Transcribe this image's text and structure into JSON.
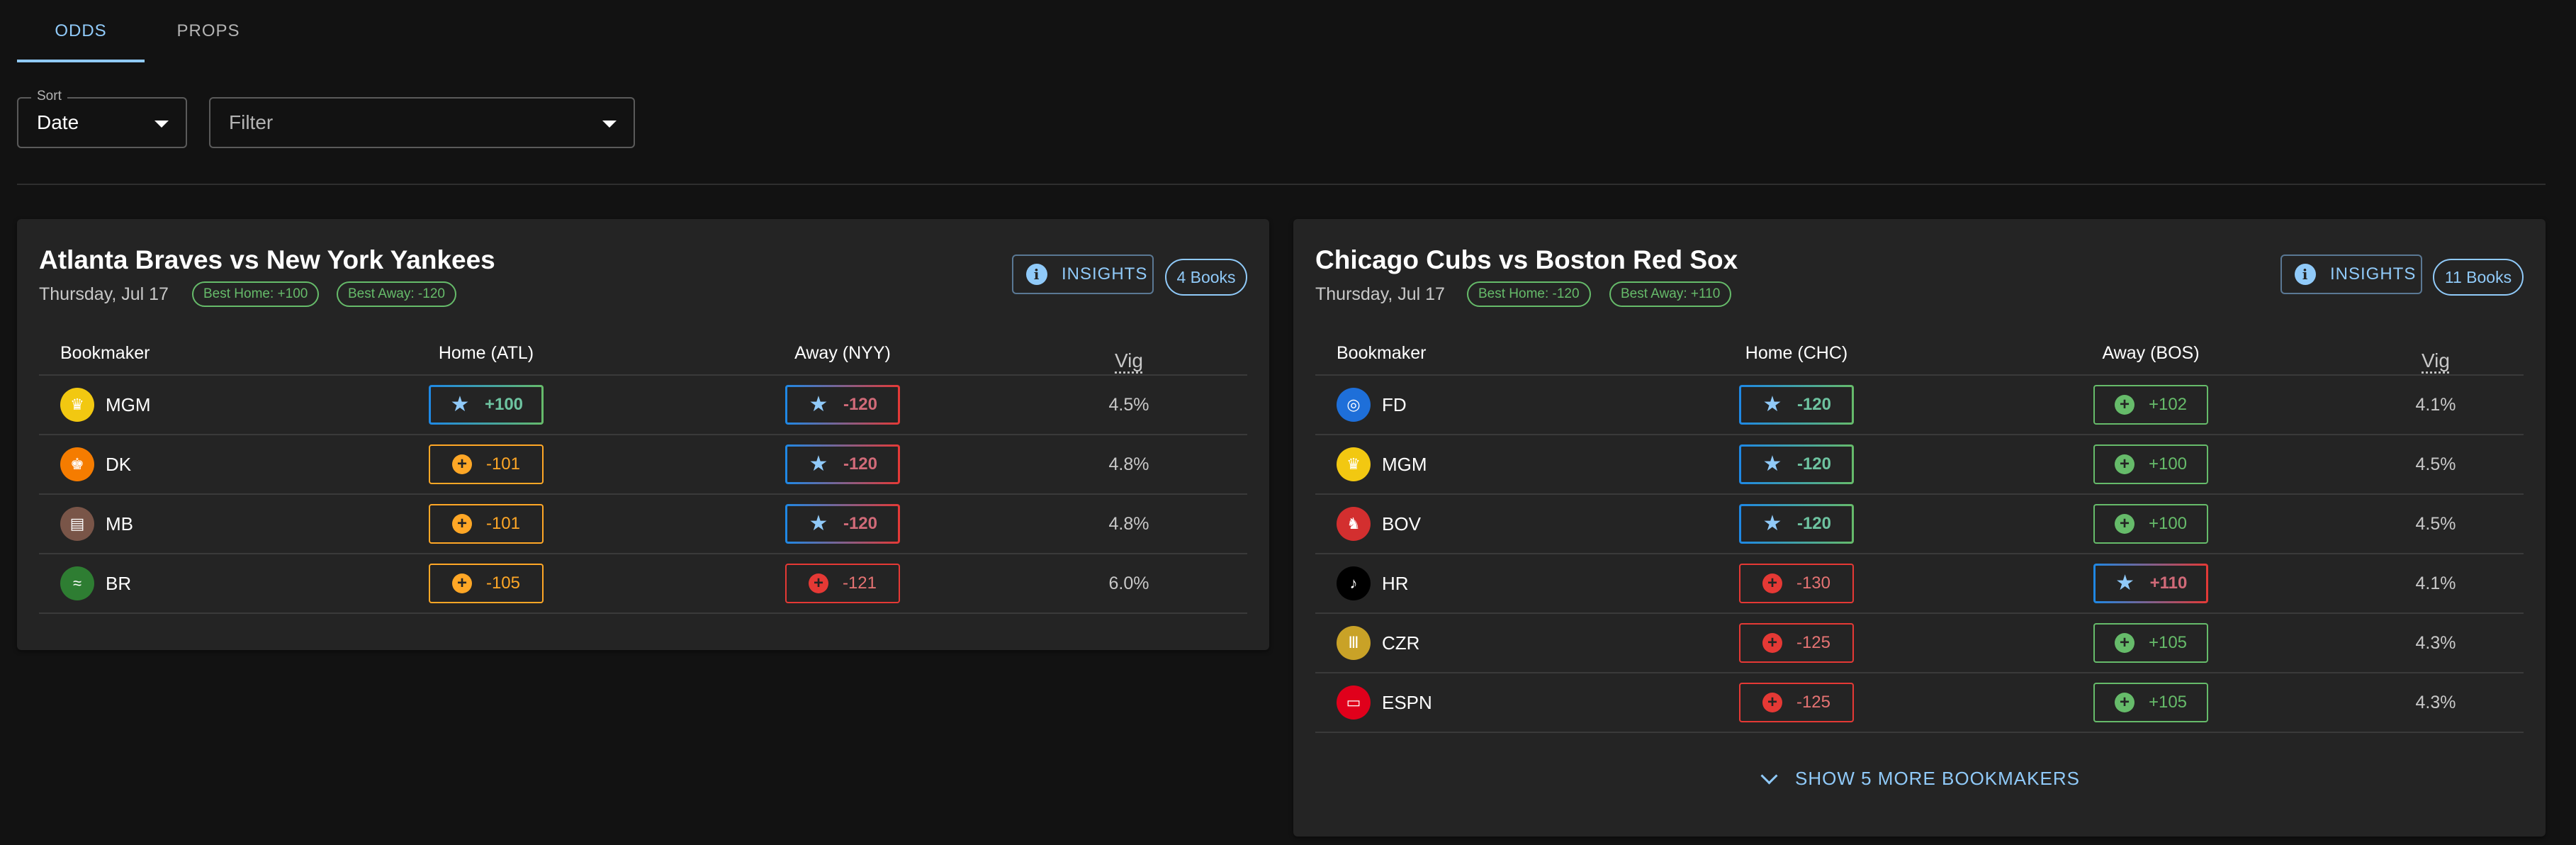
{
  "tabs": [
    {
      "label": "ODDS",
      "active": true
    },
    {
      "label": "PROPS",
      "active": false
    }
  ],
  "sort": {
    "label": "Sort",
    "value": "Date"
  },
  "filter": {
    "placeholder": "Filter"
  },
  "colors": {
    "accent": "#90caf9",
    "best_gradient_start": "#1e88e5",
    "best_home_gradient_end": "#66bb6a",
    "best_away_gradient_end": "#e53935",
    "positive": "#66bb6a",
    "negative": "#e53935",
    "warning": "#ffa726"
  },
  "games": [
    {
      "title": "Atlanta Braves vs New York Yankees",
      "date": "Thursday, Jul 17",
      "best_home": "Best Home: +100",
      "best_away": "Best Away: -120",
      "insights_label": "INSIGHTS",
      "books_label": "4 Books",
      "headers": {
        "bookmaker": "Bookmaker",
        "home": "Home (ATL)",
        "away": "Away (NYY)",
        "vig": "Vig"
      },
      "rows": [
        {
          "book": "MGM",
          "icon": "crown-icon",
          "icon_glyph": "♛",
          "icon_color": "#f2c811",
          "home": {
            "value": "+100",
            "style": "best"
          },
          "away": {
            "value": "-120",
            "style": "best"
          },
          "vig": "4.5%"
        },
        {
          "book": "DK",
          "icon": "trophy-icon",
          "icon_glyph": "♚",
          "icon_color": "#f57c00",
          "home": {
            "value": "-101",
            "style": "orange"
          },
          "away": {
            "value": "-120",
            "style": "best"
          },
          "vig": "4.8%"
        },
        {
          "book": "MB",
          "icon": "book-icon",
          "icon_glyph": "▤",
          "icon_color": "#795548",
          "home": {
            "value": "-101",
            "style": "orange"
          },
          "away": {
            "value": "-120",
            "style": "best"
          },
          "vig": "4.8%"
        },
        {
          "book": "BR",
          "icon": "wave-icon",
          "icon_glyph": "≈",
          "icon_color": "#2e7d32",
          "home": {
            "value": "-105",
            "style": "orange"
          },
          "away": {
            "value": "-121",
            "style": "red"
          },
          "vig": "6.0%"
        }
      ]
    },
    {
      "title": "Chicago Cubs vs Boston Red Sox",
      "date": "Thursday, Jul 17",
      "best_home": "Best Home: -120",
      "best_away": "Best Away: +110",
      "insights_label": "INSIGHTS",
      "books_label": "11 Books",
      "headers": {
        "bookmaker": "Bookmaker",
        "home": "Home (CHC)",
        "away": "Away (BOS)",
        "vig": "Vig"
      },
      "rows": [
        {
          "book": "FD",
          "icon": "target-icon",
          "icon_glyph": "◎",
          "icon_color": "#1e6fd9",
          "home": {
            "value": "-120",
            "style": "best"
          },
          "away": {
            "value": "+102",
            "style": "green"
          },
          "vig": "4.1%"
        },
        {
          "book": "MGM",
          "icon": "crown-icon",
          "icon_glyph": "♛",
          "icon_color": "#f2c811",
          "home": {
            "value": "-120",
            "style": "best"
          },
          "away": {
            "value": "+100",
            "style": "green"
          },
          "vig": "4.5%"
        },
        {
          "book": "BOV",
          "icon": "bull-icon",
          "icon_glyph": "♞",
          "icon_color": "#d32f2f",
          "home": {
            "value": "-120",
            "style": "best"
          },
          "away": {
            "value": "+100",
            "style": "green"
          },
          "vig": "4.5%"
        },
        {
          "book": "HR",
          "icon": "guitar-icon",
          "icon_glyph": "♪",
          "icon_color": "#000000",
          "home": {
            "value": "-130",
            "style": "red"
          },
          "away": {
            "value": "+110",
            "style": "best"
          },
          "vig": "4.1%"
        },
        {
          "book": "CZR",
          "icon": "columns-icon",
          "icon_glyph": "Ⅲ",
          "icon_color": "#c9a227",
          "home": {
            "value": "-125",
            "style": "red"
          },
          "away": {
            "value": "+105",
            "style": "green"
          },
          "vig": "4.3%"
        },
        {
          "book": "ESPN",
          "icon": "tv-icon",
          "icon_glyph": "▭",
          "icon_color": "#e0001b",
          "home": {
            "value": "-125",
            "style": "red"
          },
          "away": {
            "value": "+105",
            "style": "green"
          },
          "vig": "4.3%"
        }
      ],
      "show_more": "SHOW 5 MORE BOOKMAKERS"
    }
  ]
}
